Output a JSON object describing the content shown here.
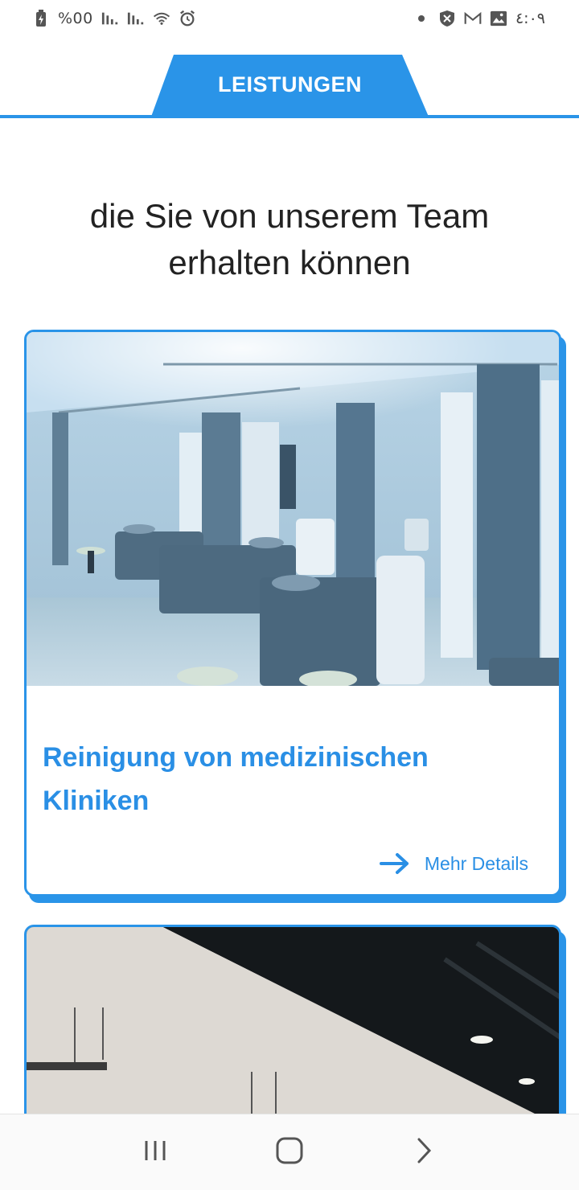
{
  "status_bar": {
    "battery_text": "%00",
    "time": "٤:٠٩",
    "icons": [
      "battery-charging-icon",
      "signal-icon",
      "signal-icon",
      "wifi-icon",
      "alarm-icon",
      "dot-icon",
      "shield-icon",
      "gmail-icon",
      "gallery-icon"
    ]
  },
  "header": {
    "tab_label": "LEISTUNGEN"
  },
  "heading": "die Sie von unserem Team erhalten können",
  "cards": [
    {
      "title": "Reinigung von medizinischen Kliniken",
      "link_label": "Mehr Details",
      "image": "hospital-room-photo"
    },
    {
      "title": "",
      "image": "office-ceiling-photo"
    }
  ],
  "nav": {
    "buttons": [
      "recent-apps-icon",
      "home-icon",
      "back-icon"
    ]
  },
  "colors": {
    "accent": "#2a94e8",
    "link": "#2a8fe5",
    "text": "#222222"
  }
}
